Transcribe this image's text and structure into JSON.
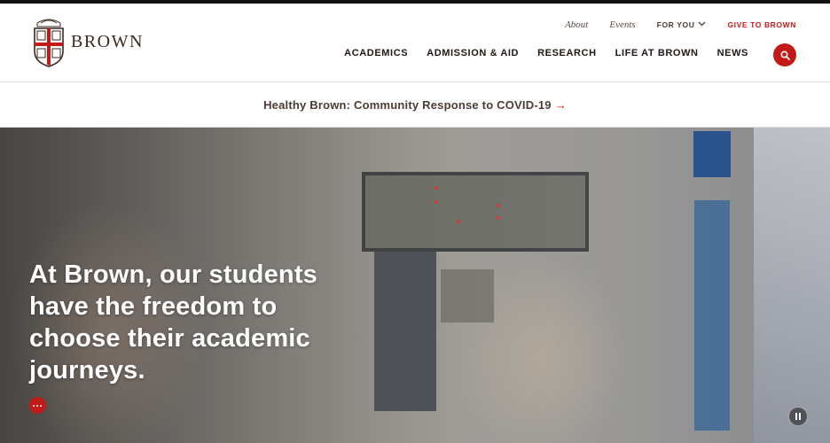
{
  "logo": {
    "wordmark": "BROWN"
  },
  "utility_nav": {
    "about": "About",
    "events": "Events",
    "for_you": "FOR YOU",
    "give": "GIVE TO BROWN"
  },
  "main_nav": {
    "items": [
      {
        "label": "ACADEMICS"
      },
      {
        "label": "ADMISSION & AID"
      },
      {
        "label": "RESEARCH"
      },
      {
        "label": "LIFE AT BROWN"
      },
      {
        "label": "NEWS"
      }
    ]
  },
  "alert_banner": {
    "text": "Healthy Brown: Community Response to COVID-19",
    "arrow": "→"
  },
  "hero": {
    "headline": "At Brown, our students have the freedom to choose their academic journeys.",
    "more_label": "···"
  },
  "icons": {
    "search": "search-icon",
    "chevron": "chevron-down-icon",
    "pause": "pause-icon",
    "shield": "brown-shield-logo"
  },
  "colors": {
    "brand_red": "#c21b17",
    "brand_brown": "#4a3c35"
  }
}
